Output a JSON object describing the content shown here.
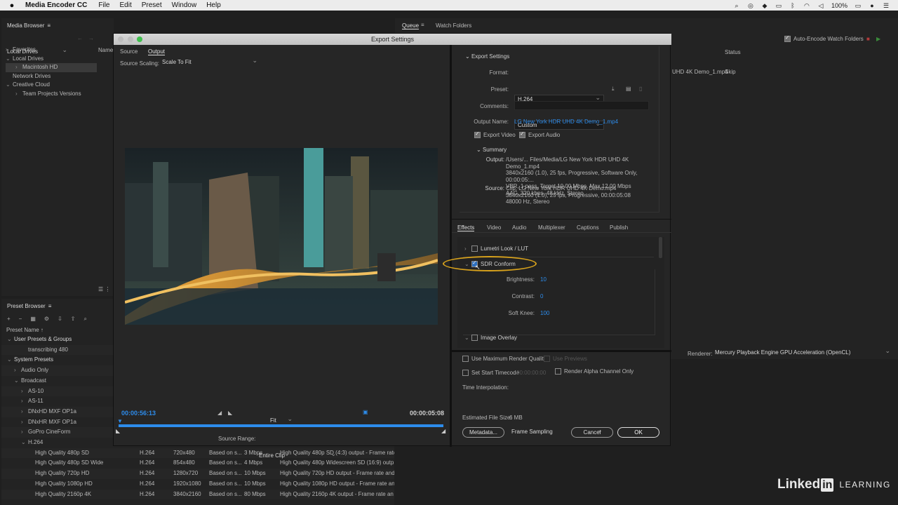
{
  "menubar": {
    "app_name": "Media Encoder CC",
    "items": [
      "File",
      "Edit",
      "Preset",
      "Window",
      "Help"
    ],
    "battery": "100%"
  },
  "media_browser": {
    "title": "Media Browser",
    "location": "Local Drives",
    "col_name": "Name",
    "tree": [
      {
        "label": "Favorites",
        "indent": 0,
        "arrow": "›"
      },
      {
        "label": "Local Drives",
        "indent": 0,
        "arrow": "⌄"
      },
      {
        "label": "Macintosh HD",
        "indent": 1,
        "arrow": "›",
        "selected": true
      },
      {
        "label": "Network Drives",
        "indent": 0,
        "arrow": ""
      },
      {
        "label": "Creative Cloud",
        "indent": 0,
        "arrow": "⌄"
      },
      {
        "label": "Team Projects Versions",
        "indent": 1,
        "arrow": "›"
      }
    ]
  },
  "queue": {
    "tab_queue": "Queue",
    "tab_watch": "Watch Folders",
    "auto_encode": "Auto-Encode Watch Folders",
    "col_status": "Status",
    "item_name": "UHD 4K Demo_1.mp4",
    "item_status": "Skip",
    "renderer_label": "Renderer:",
    "renderer_value": "Mercury Playback Engine GPU Acceleration (OpenCL)"
  },
  "preset_browser": {
    "title": "Preset Browser",
    "col_name": "Preset Name",
    "rows": [
      {
        "label": "User Presets & Groups",
        "indent": 0,
        "arrow": "⌄",
        "bold": true,
        "format": "",
        "size": "",
        "target": "",
        "bitrate": "",
        "comment": ""
      },
      {
        "label": "transcribing 480",
        "indent": 2,
        "arrow": "",
        "format": "",
        "size": "",
        "target": "",
        "bitrate": "",
        "comment": ""
      },
      {
        "label": "System Presets",
        "indent": 0,
        "arrow": "⌄",
        "bold": true,
        "format": "",
        "size": "",
        "target": "",
        "bitrate": "",
        "comment": ""
      },
      {
        "label": "Audio Only",
        "indent": 1,
        "arrow": "›",
        "format": "",
        "size": "",
        "target": "",
        "bitrate": "",
        "comment": ""
      },
      {
        "label": "Broadcast",
        "indent": 1,
        "arrow": "⌄",
        "format": "",
        "size": "",
        "target": "",
        "bitrate": "",
        "comment": ""
      },
      {
        "label": "AS-10",
        "indent": 2,
        "arrow": "›",
        "format": "",
        "size": "",
        "target": "",
        "bitrate": "",
        "comment": ""
      },
      {
        "label": "AS-11",
        "indent": 2,
        "arrow": "›",
        "format": "",
        "size": "",
        "target": "",
        "bitrate": "",
        "comment": ""
      },
      {
        "label": "DNxHD MXF OP1a",
        "indent": 2,
        "arrow": "›",
        "format": "",
        "size": "",
        "target": "",
        "bitrate": "",
        "comment": ""
      },
      {
        "label": "DNxHR MXF OP1a",
        "indent": 2,
        "arrow": "›",
        "format": "",
        "size": "",
        "target": "",
        "bitrate": "",
        "comment": ""
      },
      {
        "label": "GoPro CineForm",
        "indent": 2,
        "arrow": "›",
        "format": "",
        "size": "",
        "target": "",
        "bitrate": "",
        "comment": ""
      },
      {
        "label": "H.264",
        "indent": 2,
        "arrow": "⌄",
        "format": "",
        "size": "",
        "target": "",
        "bitrate": "",
        "comment": ""
      },
      {
        "label": "High Quality 480p SD",
        "indent": 3,
        "arrow": "",
        "format": "H.264",
        "size": "720x480",
        "target": "Based on s...",
        "bitrate": "3 Mbps",
        "comment": "High Quality 480p SD (4:3) output - Frame rate"
      },
      {
        "label": "High Quality 480p SD Wide",
        "indent": 3,
        "arrow": "",
        "format": "H.264",
        "size": "854x480",
        "target": "Based on s...",
        "bitrate": "4 Mbps",
        "comment": "High Quality 480p Widescreen SD (16:9) outp..."
      },
      {
        "label": "High Quality 720p HD",
        "indent": 3,
        "arrow": "",
        "format": "H.264",
        "size": "1280x720",
        "target": "Based on s...",
        "bitrate": "10 Mbps",
        "comment": "High Quality 720p HD output - Frame rate and"
      },
      {
        "label": "High Quality 1080p HD",
        "indent": 3,
        "arrow": "",
        "format": "H.264",
        "size": "1920x1080",
        "target": "Based on s...",
        "bitrate": "10 Mbps",
        "comment": "High Quality 1080p HD output - Frame rate an"
      },
      {
        "label": "High Quality 2160p 4K",
        "indent": 3,
        "arrow": "",
        "format": "H.264",
        "size": "3840x2160",
        "target": "Based on s...",
        "bitrate": "80 Mbps",
        "comment": "High Quality 2160p 4K output - Frame rate an"
      }
    ]
  },
  "dialog": {
    "title": "Export Settings",
    "tab_source": "Source",
    "tab_output": "Output",
    "scaling_label": "Source Scaling:",
    "scaling_value": "Scale To Fit",
    "timecode_current": "00:00:56:13",
    "timecode_end": "00:00:05:08",
    "fit_value": "Fit",
    "range_label": "Source Range:",
    "range_value": "Entire Clip",
    "section_title": "Export Settings",
    "format_label": "Format:",
    "format_value": "H.264",
    "preset_label": "Preset:",
    "preset_value": "Custom",
    "comments_label": "Comments:",
    "comments_value": "",
    "output_name_label": "Output Name:",
    "output_name_value": "LG New York HDR UHD 4K Demo_1.mp4",
    "export_video": "Export Video",
    "export_audio": "Export Audio",
    "summary_title": "Summary",
    "summary_output_label": "Output:",
    "summary_output_lines": [
      "/Users/... Files/Media/LG New York HDR UHD 4K Demo_1.mp4",
      "3840x2160 (1.0), 25 fps, Progressive, Software Only, 00:00:05:...",
      "VBR, 1 pass, Target 10.00 Mbps, Max 12.00 Mbps",
      "AAC, 320 kbps, 48 kHz, Stereo"
    ],
    "summary_source_label": "Source:",
    "summary_source_lines": [
      "Clip, LG New York HDR UHD 4K Demo.mp4",
      "3840x2160 (1.0), 25 fps, Progressive, 00:00:05:08",
      "48000 Hz, Stereo"
    ],
    "tabs": [
      "Effects",
      "Video",
      "Audio",
      "Multiplexer",
      "Captions",
      "Publish"
    ],
    "effect_lumetri": "Lumetri Look / LUT",
    "effect_sdr": "SDR Conform",
    "brightness_label": "Brightness:",
    "brightness_value": "10",
    "contrast_label": "Contrast:",
    "contrast_value": "0",
    "softknee_label": "Soft Knee:",
    "softknee_value": "100",
    "effect_overlay": "Image Overlay",
    "use_max_render": "Use Maximum Render Quality",
    "use_previews": "Use Previews",
    "set_start_tc": "Set Start Timecode",
    "start_tc_value": "00:00:00:00",
    "render_alpha": "Render Alpha Channel Only",
    "interp_label": "Time Interpolation:",
    "interp_value": "Frame Sampling",
    "filesize_label": "Estimated File Size:",
    "filesize_value": "6 MB",
    "metadata_btn": "Metadata...",
    "cancel_btn": "Cancel",
    "ok_btn": "OK"
  },
  "watermark": {
    "brand": "Linked",
    "in": "in",
    "learning": "LEARNING"
  },
  "colors": {
    "accent_blue": "#2d8ceb",
    "highlight_ring": "#d8a21c"
  }
}
